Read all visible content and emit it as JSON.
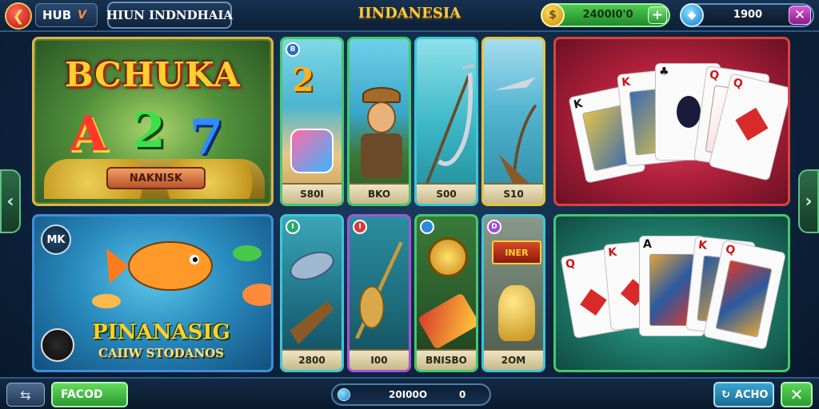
{
  "topbar": {
    "back_icon": "chevron-left-icon",
    "hub_label": "HUB",
    "hub_mark": "V",
    "title": "HIUN INDNDHAIA",
    "region": "IINDANESIA",
    "coins": {
      "icon": "coin-icon",
      "value": "2400I0'0",
      "add_label": "+"
    },
    "gems": {
      "icon": "gem-icon",
      "value": "1900",
      "close_label": "✕"
    }
  },
  "nav": {
    "left_icon": "chevron-left-icon",
    "right_icon": "chevron-right-icon"
  },
  "slot_game": {
    "title": "BCHUKA",
    "symbols": [
      "A",
      "2",
      "7"
    ],
    "plate": "NAKNISK"
  },
  "small_cards": [
    {
      "badge": "",
      "price": "S80I",
      "row": 1,
      "theme": "beach"
    },
    {
      "badge": "",
      "price": "BKO",
      "row": 1,
      "theme": "fisherman"
    },
    {
      "badge": "",
      "price": "S00",
      "row": 1,
      "theme": "rod"
    },
    {
      "badge": "",
      "price": "S10",
      "row": 1,
      "theme": "swordfish"
    },
    {
      "badge": "I",
      "price": "2800",
      "row": 2,
      "theme": "fish"
    },
    {
      "badge": "I",
      "price": "I00",
      "row": 2,
      "theme": "spear"
    },
    {
      "badge": "",
      "price": "BNISBO",
      "row": 2,
      "theme": "treasure"
    },
    {
      "badge": "D",
      "price": "2OM",
      "row": 2,
      "theme": "gold"
    }
  ],
  "small_card_badge_2": "2",
  "small_card_plate_8": "INER",
  "fish_game": {
    "emblem": "MK",
    "title": "PINANASIG",
    "subtitle": "CAIIW STODANOS"
  },
  "poker_top": {
    "cards": [
      "K",
      "K",
      "Q",
      "Q"
    ]
  },
  "poker_bottom": {
    "cards": [
      "Q",
      "K",
      "A",
      "K",
      "Q"
    ]
  },
  "bottombar": {
    "share_icon": "share-icon",
    "green_label": "FACOD",
    "search_value": "20I00O",
    "search_value2": "0",
    "acho_icon": "refresh-icon",
    "acho_label": "ACHO",
    "close_label": "✕"
  }
}
